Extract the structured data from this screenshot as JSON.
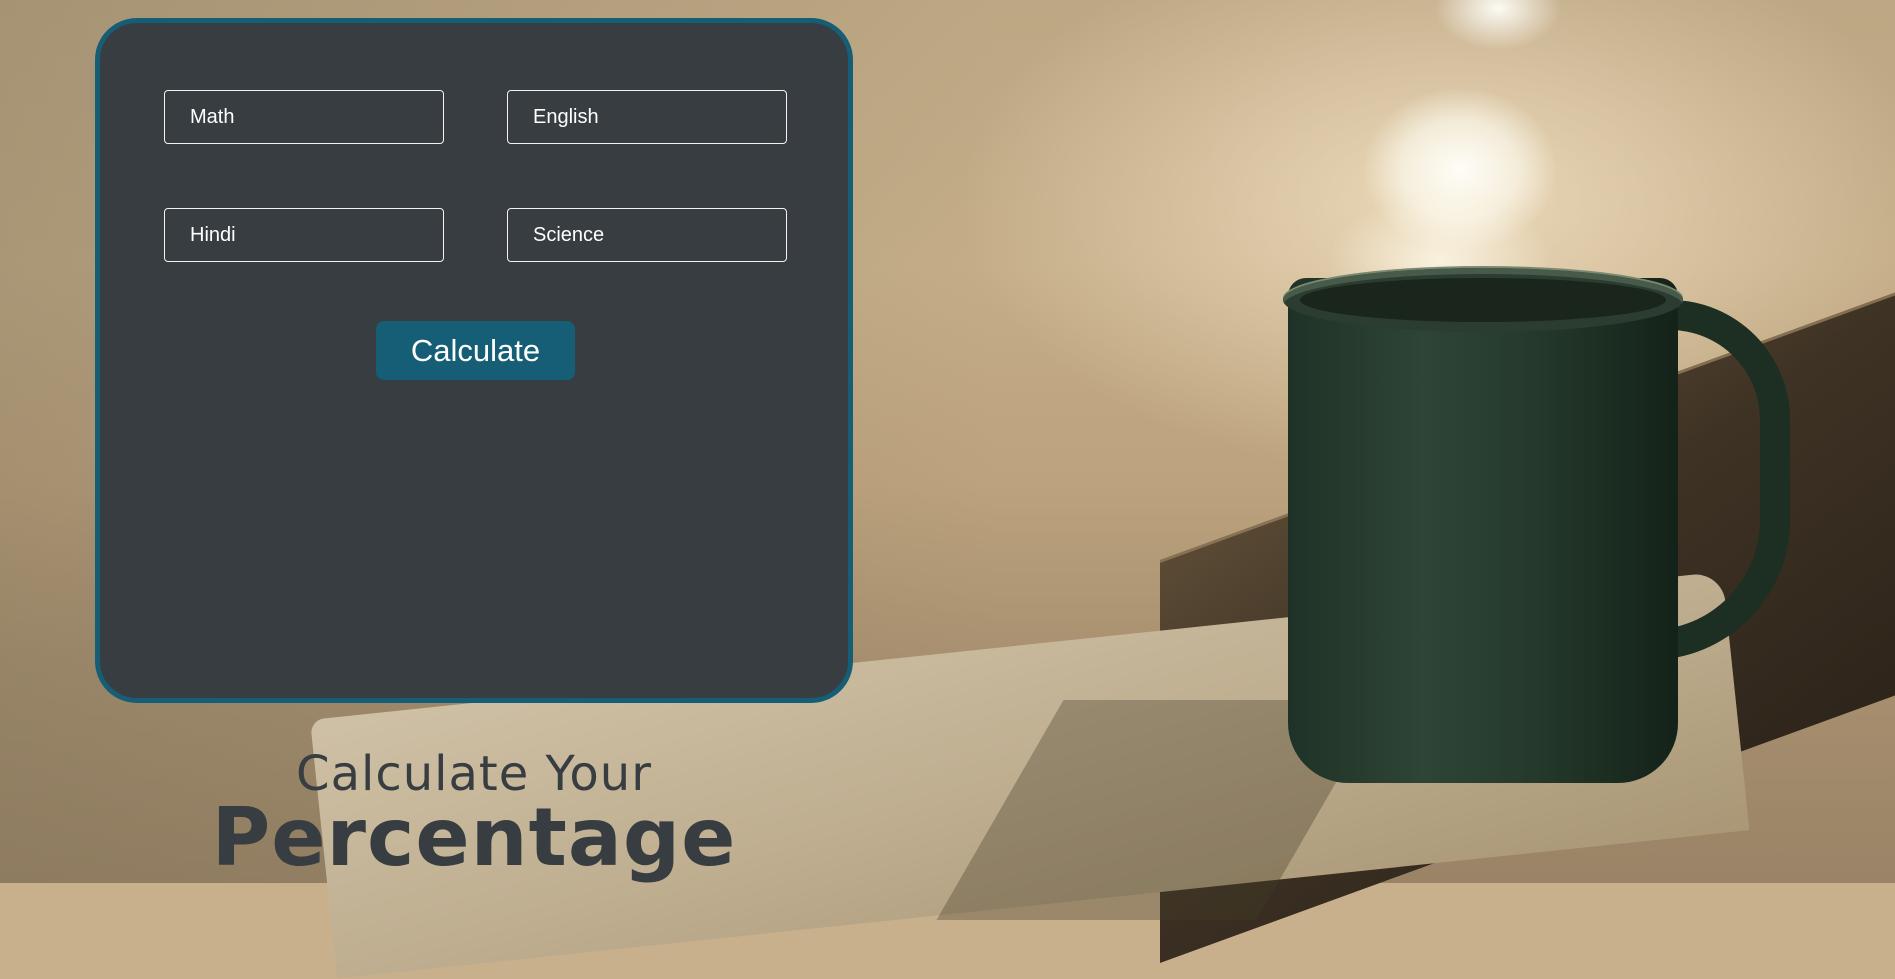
{
  "form": {
    "fields": [
      {
        "placeholder": "Math",
        "value": ""
      },
      {
        "placeholder": "English",
        "value": ""
      },
      {
        "placeholder": "Hindi",
        "value": ""
      },
      {
        "placeholder": "Science",
        "value": ""
      }
    ],
    "calculate_label": "Calculate"
  },
  "heading": {
    "line1": "Calculate Your",
    "line2": "Percentage"
  },
  "colors": {
    "panel_bg": "#373d40",
    "accent": "#155e75",
    "heading_text": "#373d40"
  }
}
